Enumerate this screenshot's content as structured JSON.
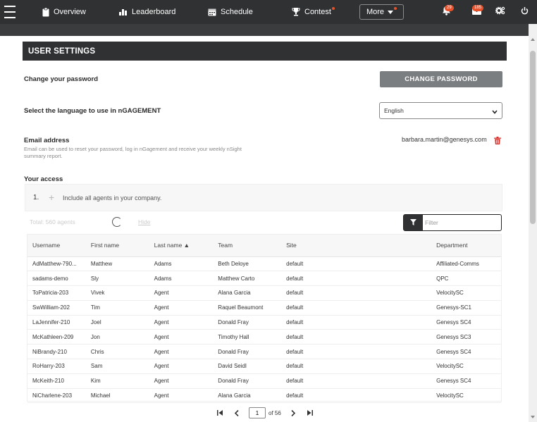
{
  "nav": {
    "overview": "Overview",
    "leaderboard": "Leaderboard",
    "schedule": "Schedule",
    "contest": "Contest",
    "more": "More",
    "notifications_count": "29",
    "messages_count": "185"
  },
  "settings": {
    "title": "USER SETTINGS",
    "change_password_label": "Change your password",
    "change_password_button": "CHANGE PASSWORD",
    "language_label": "Select the language to use in nGAGEMENT",
    "language_value": "English",
    "email_label": "Email address",
    "email_help": "Email can be used to reset your password, log in nGagement and receive your weekly nSight summary report.",
    "email_value": "barbara.martin@genesys.com",
    "access_label": "Your access",
    "access_number": "1.",
    "access_text": "Include all agents in your company.",
    "total_text": "Total: 560 agents",
    "hide_text": "Hide",
    "filter_placeholder": "Filter"
  },
  "table": {
    "columns": [
      "Username",
      "First name",
      "Last name ▲",
      "Team",
      "Site",
      "Department"
    ],
    "rows": [
      [
        "AdMatthew-790...",
        "Matthew",
        "Adams",
        "Beth Deloye",
        "default",
        "Affiliated-Comms"
      ],
      [
        "sadams-demo",
        "Sly",
        "Adams",
        "Matthew Carto",
        "default",
        "QPC"
      ],
      [
        "ToPatricia-203",
        "Vivek",
        "Agent",
        "Alana Garcia",
        "default",
        "VelocitySC"
      ],
      [
        "SwWilliam-202",
        "Tim",
        "Agent",
        "Raquel Beaumont",
        "default",
        "Genesys-SC1"
      ],
      [
        "LaJennifer-210",
        "Joel",
        "Agent",
        "Donald Fray",
        "default",
        "Genesys SC4"
      ],
      [
        "McKathleen-209",
        "Jon",
        "Agent",
        "Timothy Hall",
        "default",
        "Genesys SC3"
      ],
      [
        "NiBrandy-210",
        "Chris",
        "Agent",
        "Donald Fray",
        "default",
        "Genesys SC4"
      ],
      [
        "RoHarry-203",
        "Sam",
        "Agent",
        "David Seidl",
        "default",
        "VelocitySC"
      ],
      [
        "McKeith-210",
        "Kim",
        "Agent",
        "Donald Fray",
        "default",
        "Genesys SC4"
      ],
      [
        "NiCharlene-203",
        "Michael",
        "Agent",
        "Alana Garcia",
        "default",
        "VelocitySC"
      ]
    ]
  },
  "pagination": {
    "current_page": "1",
    "of_text": "of 56"
  },
  "colors": {
    "topbar": "#2f3133",
    "badge": "#e8512a",
    "button_gray": "#7b7e81",
    "trash_red": "#d9302c"
  }
}
